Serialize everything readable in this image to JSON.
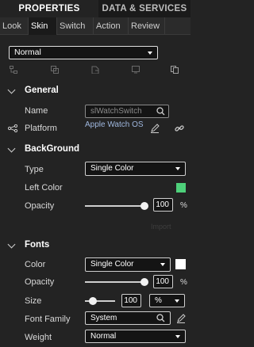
{
  "top_tabs": {
    "properties": "PROPERTIES",
    "data_services": "DATA & SERVICES"
  },
  "sub_tabs": [
    "Look",
    "Skin",
    "Switch",
    "Action",
    "Review"
  ],
  "skin_state": {
    "value": "Normal"
  },
  "sections": {
    "general": {
      "title": "General",
      "name_label": "Name",
      "name_value": "slWatchSwitch",
      "platform_label": "Platform",
      "platform_value": "Apple Watch OS"
    },
    "background": {
      "title": "BackGround",
      "type_label": "Type",
      "type_value": "Single Color",
      "left_color_label": "Left Color",
      "left_color_hex": "#4ed07a",
      "opacity_label": "Opacity",
      "opacity_value": "100",
      "opacity_unit": "%",
      "ghost_text": "Import"
    },
    "fonts": {
      "title": "Fonts",
      "color_label": "Color",
      "color_type": "Single Color",
      "color_hex": "#ffffff",
      "opacity_label": "Opacity",
      "opacity_value": "100",
      "opacity_unit": "%",
      "size_label": "Size",
      "size_value": "100",
      "size_unit": "%",
      "font_family_label": "Font Family",
      "font_family_value": "System",
      "weight_label": "Weight",
      "weight_value": "Normal"
    }
  },
  "levels": {
    "bg_opacity": 1.0,
    "font_opacity": 1.0,
    "font_size": 0.25
  },
  "colors": {
    "accent_green": "#4ed07a",
    "link_blue": "#9fb7de",
    "background": "#232323"
  }
}
